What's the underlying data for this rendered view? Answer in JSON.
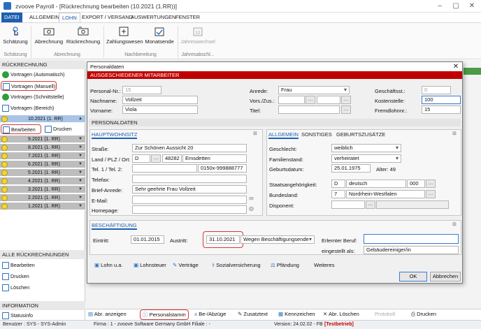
{
  "window": {
    "title": "zvoove Payroll - [Rückrechnung bearbeiten (10.2021 (1.RR))]"
  },
  "ribbon_tabs": [
    {
      "label": "DATEI"
    },
    {
      "label": "ALLGEMEIN"
    },
    {
      "label": "LOHN"
    },
    {
      "label": "EXPORT / VERSAND"
    },
    {
      "label": "AUSWERTUNGEN"
    },
    {
      "label": "FENSTER"
    }
  ],
  "ribbon": {
    "schaetzung": "Schätzung",
    "abrechnung": "Abrechnung",
    "rueckrechnung": "Rückrechnung",
    "zahlungswesen": "Zahlungswesen",
    "monatsende": "Monatsende",
    "jahreswechsel": "Jahreswechsel",
    "groups": [
      "Schätzung",
      "Abrechnung",
      "Nachbereitung",
      "Jahresabschl..."
    ]
  },
  "left": {
    "rueckrechnung_header": "RÜCKRECHNUNG",
    "vortragen_auto": "Vortragen (Automatisch)",
    "vortragen_manuell": "Vortragen (Manuell)",
    "vortragen_schnitt": "Vortragen (Schnittstelle)",
    "vortragen_bereich": "Vortragen (Bereich)",
    "current_period": "10.2021 (1. RR)",
    "bearbeiten": "Bearbeiten",
    "drucken": "Drucken",
    "periods": [
      "9.2021 (1. RR)",
      "8.2021 (1. RR)",
      "7.2021 (1. RR)",
      "6.2021 (1. RR)",
      "5.2021 (1. RR)",
      "4.2021 (1. RR)",
      "3.2021 (1. RR)",
      "2.2021 (1. RR)",
      "1.2021 (1. RR)"
    ],
    "alle_header": "ALLE RÜCKRECHNUNGEN",
    "alle_bearbeiten": "Bearbeiten",
    "alle_drucken": "Drucken",
    "alle_loeschen": "Löschen",
    "info_header": "INFORMATION",
    "statusinfo": "Statusinfo"
  },
  "dialog": {
    "title": "Personaldaten",
    "banner": "AUSGESCHIEDENER MITARBEITER",
    "personal_nr_label": "Personal-Nr.:",
    "personal_nr": "15",
    "nachname_label": "Nachname:",
    "nachname": "Vollzeit",
    "vorname_label": "Vorname:",
    "vorname": "Viola",
    "anrede_label": "Anrede:",
    "anrede": "Frau",
    "vors_label": "Vors./Zus.:",
    "titel_label": "Titel:",
    "geschaeftsst_label": "Geschäftsst.:",
    "geschaeftsst": "0",
    "kostenstelle_label": "Kostenstelle:",
    "kostenstelle": "100",
    "fremdlohn_label": "Fremdlohnnr.:",
    "fremdlohn": "15",
    "personaldaten_section": "PERSONALDATEN",
    "hauptwohnsitz_tab": "HAUPTWOHNSITZ",
    "strasse_label": "Straße:",
    "strasse": "Zur Schönen Aussicht 20",
    "land_label": "Land / PLZ / Ort:",
    "land": "D",
    "plz": "48282",
    "ort": "Emsdetten",
    "tel_label": "Tel. 1 / Tel. 2:",
    "tel2": "0150x-999888777",
    "telefax_label": "Telefax:",
    "briefanrede_label": "Brief-Anrede:",
    "briefanrede": "Sehr geehrte Frau Vollzeit",
    "email_label": "E-Mail:",
    "homepage_label": "Homepage:",
    "tab_allgemein": "ALLGEMEIN",
    "tab_sonstiges": "SONSTIGES",
    "tab_geburt": "GEBURTSZUSÄTZE",
    "geschlecht_label": "Geschlecht:",
    "geschlecht": "weiblich",
    "familienstand_label": "Familienstand:",
    "familienstand": "verheiratet",
    "geburtsdatum_label": "Geburtsdatum:",
    "geburtsdatum": "25.01.1975",
    "alter": "Alter: 49",
    "staatsang_label": "Staatsangehörigkeit:",
    "staatsang_code": "D",
    "staatsang": "deutsch",
    "staatsang_num": "000",
    "bundesland_label": "Bundesland:",
    "bundesland_code": "7",
    "bundesland": "Nordrhein-Westfalen",
    "disponent_label": "Disponent:",
    "beschaeftigung_tab": "BESCHÄFTIGUNG",
    "eintritt_label": "Eintritt:",
    "eintritt": "01.01.2015",
    "austritt_label": "Austritt:",
    "austritt": "31.10.2021",
    "austritt_grund": "Wegen Beschäftigungsende",
    "beruf_label": "Erlernter Beruf:",
    "eingestellt_label": "eingestellt als:",
    "eingestellt": "Gebäudereiniger/in",
    "links": [
      "Lohn u.a.",
      "Lohnsteuer",
      "Verträge",
      "Sozialversicherung",
      "Pfändung",
      "Weiteres"
    ],
    "ok": "OK",
    "abbrechen": "Abbrechen"
  },
  "toolbar": {
    "abr_anzeigen": "Abr. anzeigen",
    "personalstamm": "Personalstamm",
    "be_abzuege": "Be-/Abzüge",
    "zusatztext": "Zusatztext",
    "kennzeichen": "Kennzeichen",
    "abr_loeschen": "Abr. Löschen",
    "protokoll": "Protokoll",
    "drucken": "Drucken"
  },
  "status": {
    "user": "Benutzer : SYS - SYS-Admin",
    "firma": "Firma : 1 - zvoove Software Germany GmbH   Filiale : -",
    "version": "Version: 24.02.02 - FB",
    "testbetrieb": "[Testbetrieb]"
  },
  "colors": {
    "accent": "#1e5fb0",
    "banner": "#c00000",
    "highlight": "#d23b3b"
  }
}
